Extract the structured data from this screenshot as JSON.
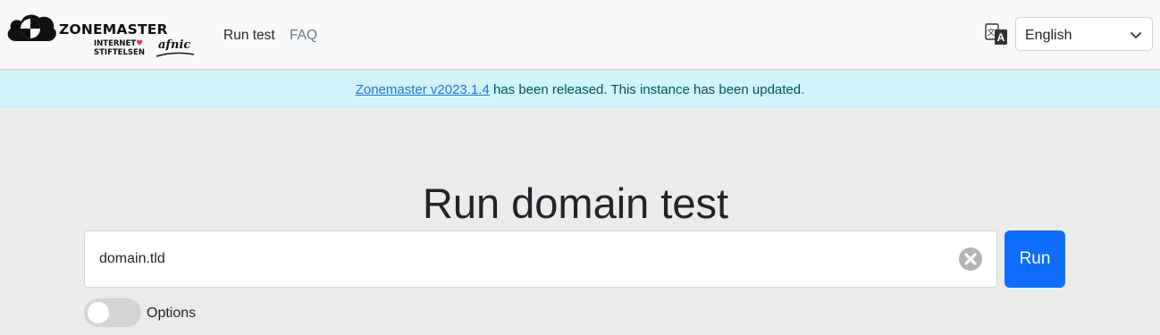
{
  "header": {
    "brand": "ZONEMASTER",
    "sponsor1_line1": "INTERNET",
    "sponsor1_line2": "STIFTELSEN",
    "sponsor2": "afnic",
    "nav": [
      {
        "label": "Run test"
      },
      {
        "label": "FAQ"
      }
    ],
    "language": {
      "selected": "English",
      "icon": "translate-icon"
    }
  },
  "alert": {
    "link_text": "Zonemaster v2023.1.4",
    "message": " has been released. This instance has been updated."
  },
  "main": {
    "title": "Run domain test",
    "input_value": "domain.tld",
    "run_label": "Run",
    "options_label": "Options",
    "options_enabled": false
  },
  "colors": {
    "primary": "#0d6efd",
    "alert_bg": "#cff4fc",
    "page_bg": "#ebebeb"
  }
}
